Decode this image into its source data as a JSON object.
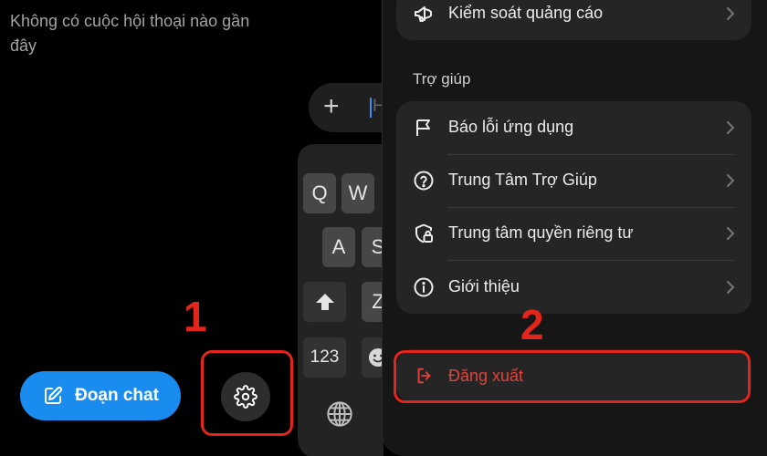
{
  "left": {
    "empty_message": "Không có cuộc hội thoại nào gần đây",
    "new_chat_label": "Đoạn chat"
  },
  "composer": {
    "placeholder": "Hỏ"
  },
  "keyboard": {
    "rows": [
      [
        "Q",
        "W"
      ],
      [
        "A",
        "S"
      ],
      [
        "Z"
      ]
    ],
    "numbers_key": "123"
  },
  "menu": {
    "top_item": "Kiểm soát quảng cáo",
    "section_title": "Trợ giúp",
    "help_items": [
      {
        "label": "Báo lỗi ứng dụng",
        "icon": "flag-icon"
      },
      {
        "label": "Trung Tâm Trợ Giúp",
        "icon": "question-circle-icon"
      },
      {
        "label": "Trung tâm quyền riêng tư",
        "icon": "privacy-lock-icon"
      },
      {
        "label": "Giới thiệu",
        "icon": "info-icon"
      }
    ],
    "logout_label": "Đăng xuất"
  },
  "annotations": {
    "step1": "1",
    "step2": "2",
    "color": "#e3251c"
  },
  "colors": {
    "accent": "#1a8cf0",
    "danger": "#e0433a"
  }
}
